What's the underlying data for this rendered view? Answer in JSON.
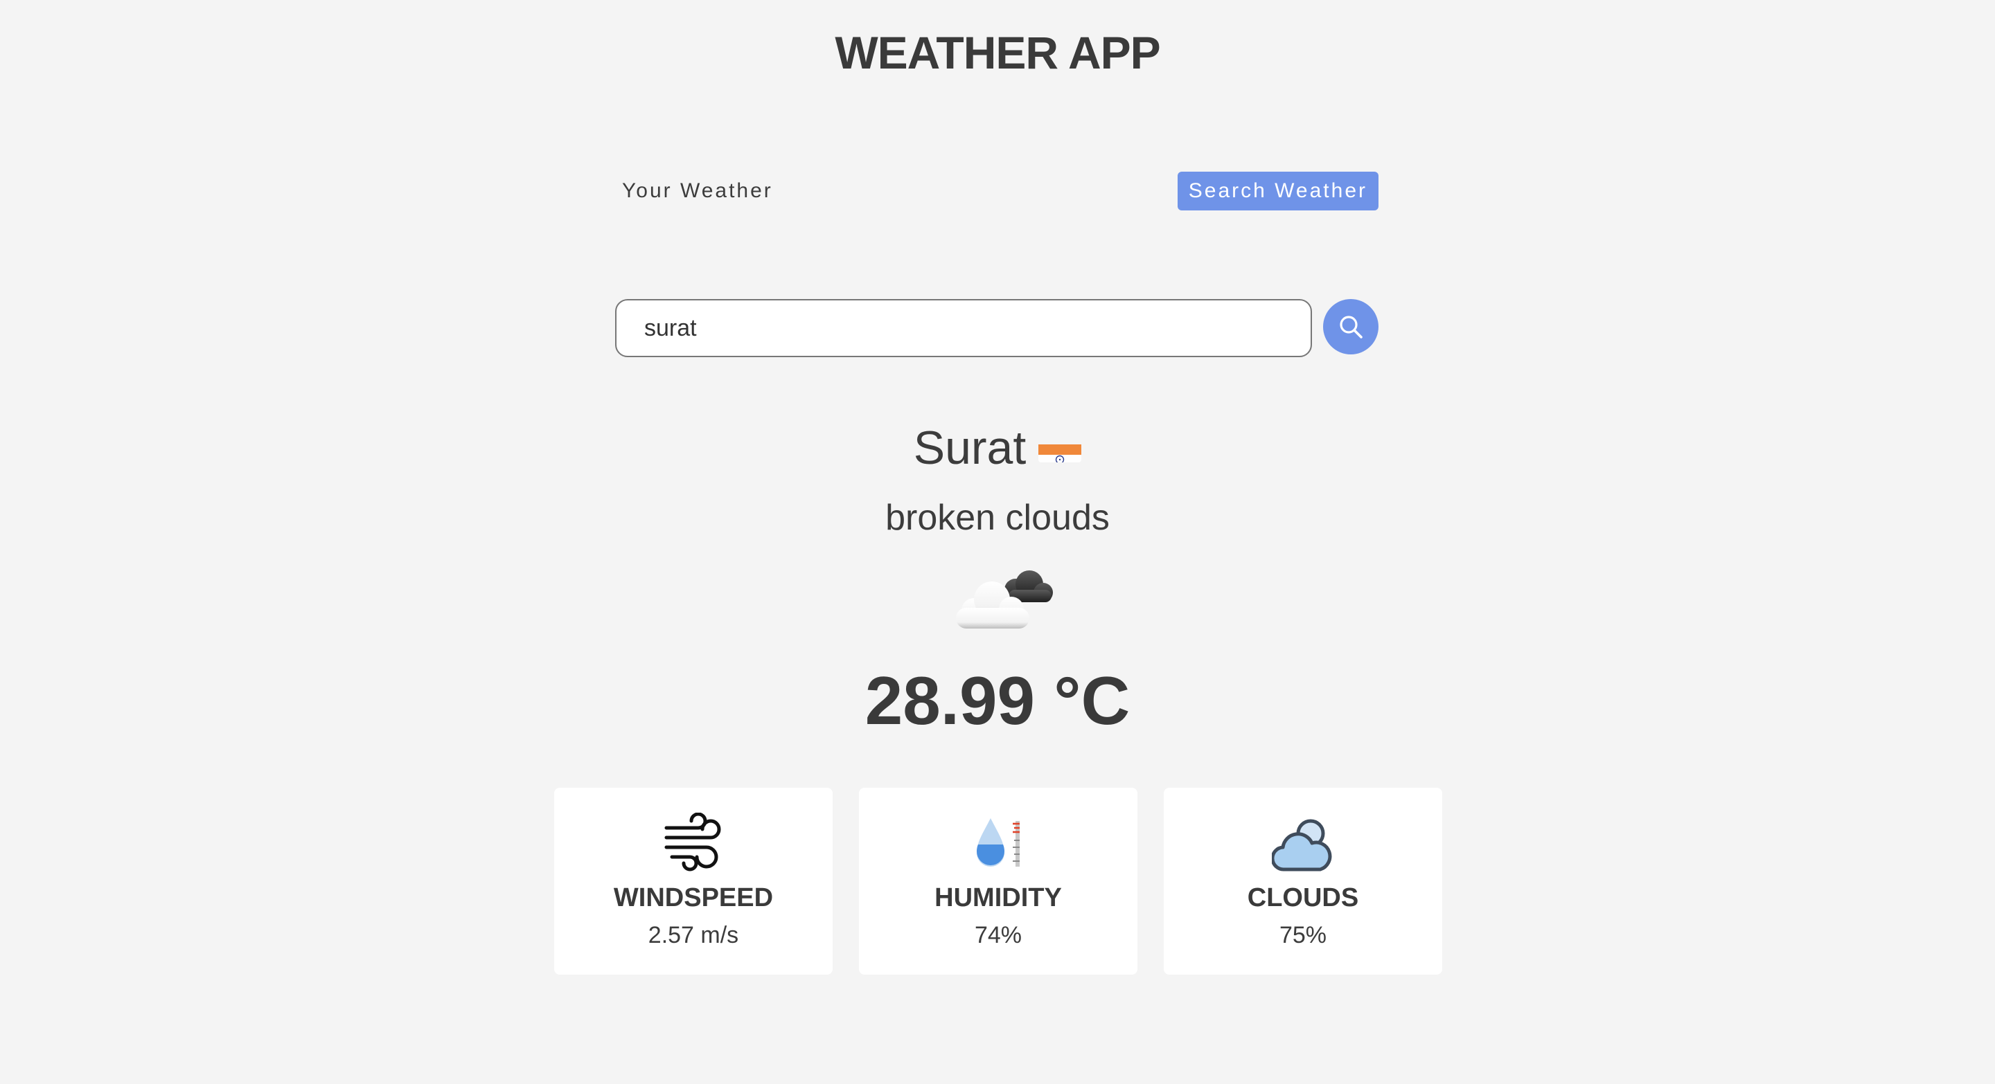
{
  "app": {
    "title": "WEATHER APP"
  },
  "tabs": [
    {
      "label": "Your Weather",
      "active": false
    },
    {
      "label": "Search Weather",
      "active": true
    }
  ],
  "search": {
    "value": "surat",
    "placeholder": ""
  },
  "weather": {
    "city": "Surat",
    "description": "broken clouds",
    "temperature": "28.99 °C"
  },
  "stats": [
    {
      "label": "WINDSPEED",
      "value": "2.57 m/s"
    },
    {
      "label": "HUMIDITY",
      "value": "74%"
    },
    {
      "label": "CLOUDS",
      "value": "75%"
    }
  ],
  "colors": {
    "accent": "#6f93e8",
    "background": "#f4f4f4",
    "card": "#ffffff",
    "text": "#3a3a3a"
  },
  "icons": {
    "search": "search-icon",
    "flag": "india-flag-icon",
    "condition": "broken-clouds-icon",
    "windspeed": "wind-icon",
    "humidity": "humidity-icon",
    "clouds": "cloud-icon"
  }
}
